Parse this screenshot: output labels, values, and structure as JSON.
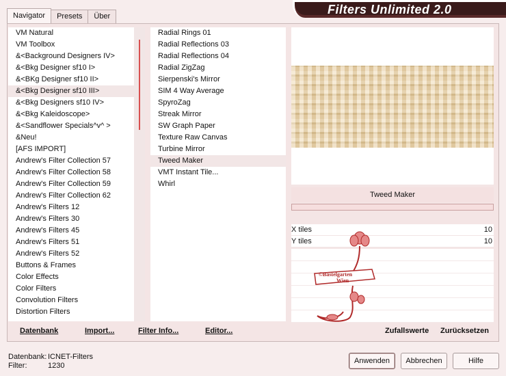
{
  "window": {
    "title": "Filters Unlimited 2.0"
  },
  "tabs": [
    {
      "label": "Navigator",
      "active": true
    },
    {
      "label": "Presets",
      "active": false
    },
    {
      "label": "Über",
      "active": false
    }
  ],
  "categories": [
    "VM Natural",
    "VM Toolbox",
    "&<Background Designers IV>",
    "&<Bkg Designer sf10 I>",
    "&<BKg Designer sf10 II>",
    "&<Bkg Designer sf10 III>",
    "&<Bkg Designers sf10 IV>",
    "&<Bkg Kaleidoscope>",
    "&<Sandflower Specials^v^ >",
    "&Neu!",
    "[AFS IMPORT]",
    "Andrew's Filter Collection 57",
    "Andrew's Filter Collection 58",
    "Andrew's Filter Collection 59",
    "Andrew's Filter Collection 62",
    "Andrew's Filters 12",
    "Andrew's Filters 30",
    "Andrew's Filters 45",
    "Andrew's Filters 51",
    "Andrew's Filters 52",
    "Buttons & Frames",
    "Color Effects",
    "Color Filters",
    "Convolution Filters",
    "Distortion Filters"
  ],
  "selected_category": "&<Bkg Designer sf10 III>",
  "filters": [
    "Radial  Rings 01",
    "Radial Reflections 03",
    "Radial Reflections 04",
    "Radial ZigZag",
    "Sierpenski's Mirror",
    "SIM 4 Way Average",
    "SpyroZag",
    "Streak Mirror",
    "SW Graph Paper",
    "Texture Raw Canvas",
    "Turbine Mirror",
    "Tweed Maker",
    "VMT Instant Tile...",
    "Whirl"
  ],
  "selected_filter": "Tweed Maker",
  "preview": {
    "filter_name": "Tweed Maker"
  },
  "params": [
    {
      "label": "X tiles",
      "value": "10"
    },
    {
      "label": "Y tiles",
      "value": "10"
    }
  ],
  "watermark": {
    "line1": "©Bastelgarten",
    "line2": "Wien"
  },
  "toolbar": {
    "datenbank": "Datenbank",
    "import": "Import...",
    "filter_info": "Filter Info...",
    "editor": "Editor...",
    "zufallswerte": "Zufallswerte",
    "zuruecksetzen": "Zurücksetzen"
  },
  "status": {
    "db_label": "Datenbank:",
    "db_value": "ICNET-Filters",
    "filter_label": "Filter:",
    "filter_value": "1230"
  },
  "buttons": {
    "apply": "Anwenden",
    "cancel": "Abbrechen",
    "help": "Hilfe"
  },
  "colors": {
    "titlebar": "#3a1b1b",
    "accent": "#d85050",
    "panel": "#f4e5e5"
  }
}
